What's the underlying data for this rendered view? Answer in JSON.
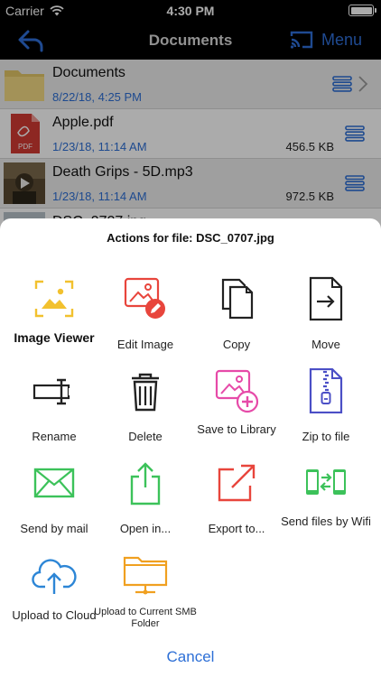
{
  "status_bar": {
    "carrier": "Carrier",
    "time": "4:30 PM"
  },
  "nav": {
    "title": "Documents",
    "menu_label": "Menu"
  },
  "files": [
    {
      "name": "Documents",
      "date": "8/22/18, 4:25 PM",
      "size": ""
    },
    {
      "name": "Apple.pdf",
      "date": "1/23/18, 11:14 AM",
      "size": "456.5 KB",
      "thumb_label": "PDF"
    },
    {
      "name": "Death Grips - 5D.mp3",
      "date": "1/23/18, 11:14 AM",
      "size": "972.5 KB"
    },
    {
      "name": "DSC_0707.jpg",
      "date": "",
      "size": ""
    }
  ],
  "sheet": {
    "title": "Actions for file: DSC_0707.jpg",
    "cancel_label": "Cancel",
    "actions": [
      {
        "label": "Image Viewer",
        "icon": "image-viewer-icon",
        "color": "#f2c12e"
      },
      {
        "label": "Edit Image",
        "icon": "edit-image-icon",
        "color": "#e8453c"
      },
      {
        "label": "Copy",
        "icon": "copy-icon",
        "color": "#222222"
      },
      {
        "label": "Move",
        "icon": "move-icon",
        "color": "#222222"
      },
      {
        "label": "Rename",
        "icon": "rename-icon",
        "color": "#222222"
      },
      {
        "label": "Delete",
        "icon": "trash-icon",
        "color": "#222222"
      },
      {
        "label": "Save to Library",
        "icon": "save-to-library-icon",
        "color": "#e64aa8"
      },
      {
        "label": "Zip to file",
        "icon": "zip-icon",
        "color": "#4b4fc6"
      },
      {
        "label": "Send by mail",
        "icon": "mail-icon",
        "color": "#3cc25a"
      },
      {
        "label": "Open in...",
        "icon": "share-icon",
        "color": "#3cc25a"
      },
      {
        "label": "Export to...",
        "icon": "export-icon",
        "color": "#e8453c"
      },
      {
        "label": "Send files by Wifi",
        "icon": "wifi-transfer-icon",
        "color": "#3cc25a"
      },
      {
        "label": "Upload to Cloud",
        "icon": "cloud-upload-icon",
        "color": "#2d86d6"
      },
      {
        "label": "Upload to Current SMB Folder",
        "icon": "smb-folder-icon",
        "color": "#f0a020"
      }
    ]
  },
  "colors": {
    "accent": "#2d6fd6",
    "nav_bg": "#000000"
  }
}
